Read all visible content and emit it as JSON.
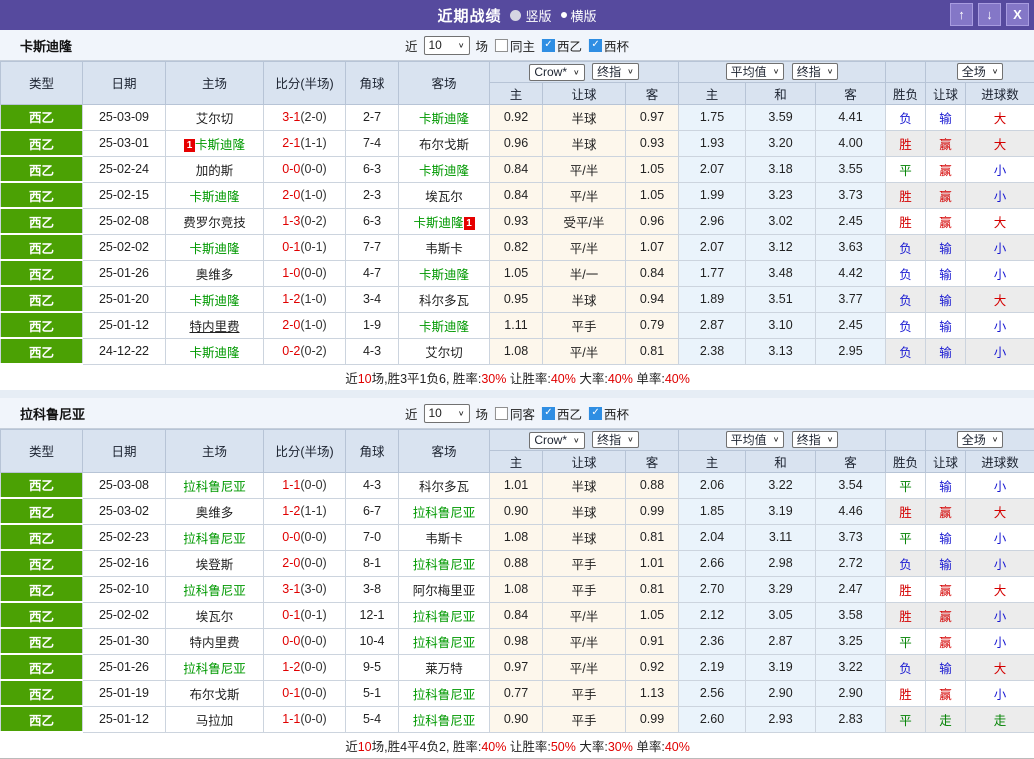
{
  "titlebar": {
    "title": "近期战绩",
    "vertical_label": "竖版",
    "horizontal_label": "横版"
  },
  "icons": {
    "chevron_down": "∨",
    "check": "✓",
    "up_arrow": "↑",
    "down_arrow": "↓",
    "close": "X"
  },
  "colors": {
    "accent": "#564a9e",
    "league_green": "#4ba104",
    "focus_green": "#009900",
    "score_red": "#e00000",
    "result_red": "#d40000",
    "result_blue": "#1a1ad2",
    "result_green": "#028202",
    "checkbox_blue": "#2f8ee3",
    "odds_cream_bg": "#fdf7ec",
    "avg_blue_bg": "#eaf3fb",
    "header_bg": "#d9e3f0"
  },
  "columns": {
    "main": [
      "类型",
      "日期",
      "主场",
      "比分(半场)",
      "角球",
      "客场"
    ],
    "sub": [
      "主",
      "让球",
      "客",
      "主",
      "和",
      "客",
      "胜负",
      "让球",
      "进球数"
    ]
  },
  "selects": {
    "crow": "Crow*",
    "final": "终指",
    "avg": "平均值",
    "full": "全场"
  },
  "tables": [
    {
      "team": "卡斯迪隆",
      "filter": {
        "near": "近",
        "count": "10",
        "games": "场",
        "same_label": "同主",
        "same_checked": false,
        "league_label": "西乙",
        "league_checked": true,
        "cup_label": "西杯",
        "cup_checked": true
      },
      "rows": [
        {
          "league": "西乙",
          "date": "25-03-09",
          "home": {
            "name": "艾尔切",
            "style": "normal"
          },
          "score": "3-1",
          "half": "(2-0)",
          "corner": "2-7",
          "away": {
            "name": "卡斯迪隆",
            "style": "focus"
          },
          "crow": [
            "0.92",
            "半球",
            "0.97"
          ],
          "avg": [
            "1.75",
            "3.59",
            "4.41"
          ],
          "result": [
            {
              "t": "负",
              "c": "blue"
            },
            {
              "t": "输",
              "c": "blue"
            },
            {
              "t": "大",
              "c": "red"
            }
          ]
        },
        {
          "league": "西乙",
          "date": "25-03-01",
          "home": {
            "name": "卡斯迪隆",
            "style": "focus",
            "badge": "1",
            "badge_pos": "before"
          },
          "score": "2-1",
          "half": "(1-1)",
          "corner": "7-4",
          "away": {
            "name": "布尔戈斯",
            "style": "normal"
          },
          "crow": [
            "0.96",
            "半球",
            "0.93"
          ],
          "avg": [
            "1.93",
            "3.20",
            "4.00"
          ],
          "result": [
            {
              "t": "胜",
              "c": "red"
            },
            {
              "t": "赢",
              "c": "red"
            },
            {
              "t": "大",
              "c": "red"
            }
          ]
        },
        {
          "league": "西乙",
          "date": "25-02-24",
          "home": {
            "name": "加的斯",
            "style": "normal"
          },
          "score": "0-0",
          "half": "(0-0)",
          "corner": "6-3",
          "away": {
            "name": "卡斯迪隆",
            "style": "focus"
          },
          "crow": [
            "0.84",
            "平/半",
            "1.05"
          ],
          "avg": [
            "2.07",
            "3.18",
            "3.55"
          ],
          "result": [
            {
              "t": "平",
              "c": "green"
            },
            {
              "t": "赢",
              "c": "red"
            },
            {
              "t": "小",
              "c": "blue"
            }
          ]
        },
        {
          "league": "西乙",
          "date": "25-02-15",
          "home": {
            "name": "卡斯迪隆",
            "style": "focus"
          },
          "score": "2-0",
          "half": "(1-0)",
          "corner": "2-3",
          "away": {
            "name": "埃瓦尔",
            "style": "normal"
          },
          "crow": [
            "0.84",
            "平/半",
            "1.05"
          ],
          "avg": [
            "1.99",
            "3.23",
            "3.73"
          ],
          "result": [
            {
              "t": "胜",
              "c": "red"
            },
            {
              "t": "赢",
              "c": "red"
            },
            {
              "t": "小",
              "c": "blue"
            }
          ]
        },
        {
          "league": "西乙",
          "date": "25-02-08",
          "home": {
            "name": "费罗尔竞技",
            "style": "normal"
          },
          "score": "1-3",
          "half": "(0-2)",
          "corner": "6-3",
          "away": {
            "name": "卡斯迪隆",
            "style": "focus",
            "badge": "1",
            "badge_pos": "after"
          },
          "crow": [
            "0.93",
            "受平/半",
            "0.96"
          ],
          "avg": [
            "2.96",
            "3.02",
            "2.45"
          ],
          "result": [
            {
              "t": "胜",
              "c": "red"
            },
            {
              "t": "赢",
              "c": "red"
            },
            {
              "t": "大",
              "c": "red"
            }
          ]
        },
        {
          "league": "西乙",
          "date": "25-02-02",
          "home": {
            "name": "卡斯迪隆",
            "style": "focus"
          },
          "score": "0-1",
          "half": "(0-1)",
          "corner": "7-7",
          "away": {
            "name": "韦斯卡",
            "style": "normal"
          },
          "crow": [
            "0.82",
            "平/半",
            "1.07"
          ],
          "avg": [
            "2.07",
            "3.12",
            "3.63"
          ],
          "result": [
            {
              "t": "负",
              "c": "blue"
            },
            {
              "t": "输",
              "c": "blue"
            },
            {
              "t": "小",
              "c": "blue"
            }
          ]
        },
        {
          "league": "西乙",
          "date": "25-01-26",
          "home": {
            "name": "奥维多",
            "style": "normal"
          },
          "score": "1-0",
          "half": "(0-0)",
          "corner": "4-7",
          "away": {
            "name": "卡斯迪隆",
            "style": "focus"
          },
          "crow": [
            "1.05",
            "半/一",
            "0.84"
          ],
          "avg": [
            "1.77",
            "3.48",
            "4.42"
          ],
          "result": [
            {
              "t": "负",
              "c": "blue"
            },
            {
              "t": "输",
              "c": "blue"
            },
            {
              "t": "小",
              "c": "blue"
            }
          ]
        },
        {
          "league": "西乙",
          "date": "25-01-20",
          "home": {
            "name": "卡斯迪隆",
            "style": "focus"
          },
          "score": "1-2",
          "half": "(1-0)",
          "corner": "3-4",
          "away": {
            "name": "科尔多瓦",
            "style": "normal"
          },
          "crow": [
            "0.95",
            "半球",
            "0.94"
          ],
          "avg": [
            "1.89",
            "3.51",
            "3.77"
          ],
          "result": [
            {
              "t": "负",
              "c": "blue"
            },
            {
              "t": "输",
              "c": "blue"
            },
            {
              "t": "大",
              "c": "red"
            }
          ]
        },
        {
          "league": "西乙",
          "date": "25-01-12",
          "home": {
            "name": "特内里费",
            "style": "underline"
          },
          "score": "2-0",
          "half": "(1-0)",
          "corner": "1-9",
          "away": {
            "name": "卡斯迪隆",
            "style": "focus"
          },
          "crow": [
            "1.11",
            "平手",
            "0.79"
          ],
          "avg": [
            "2.87",
            "3.10",
            "2.45"
          ],
          "result": [
            {
              "t": "负",
              "c": "blue"
            },
            {
              "t": "输",
              "c": "blue"
            },
            {
              "t": "小",
              "c": "blue"
            }
          ]
        },
        {
          "league": "西乙",
          "date": "24-12-22",
          "home": {
            "name": "卡斯迪隆",
            "style": "focus"
          },
          "score": "0-2",
          "half": "(0-2)",
          "corner": "4-3",
          "away": {
            "name": "艾尔切",
            "style": "normal"
          },
          "crow": [
            "1.08",
            "平/半",
            "0.81"
          ],
          "avg": [
            "2.38",
            "3.13",
            "2.95"
          ],
          "result": [
            {
              "t": "负",
              "c": "blue"
            },
            {
              "t": "输",
              "c": "blue"
            },
            {
              "t": "小",
              "c": "blue"
            }
          ]
        }
      ],
      "footer": [
        {
          "t": "近",
          "red": false
        },
        {
          "t": "10",
          "red": true
        },
        {
          "t": "场,胜3平1负6, 胜率:",
          "red": false
        },
        {
          "t": "30%",
          "red": true
        },
        {
          "t": " 让胜率:",
          "red": false
        },
        {
          "t": "40%",
          "red": true
        },
        {
          "t": " 大率:",
          "red": false
        },
        {
          "t": "40%",
          "red": true
        },
        {
          "t": " 单率:",
          "red": false
        },
        {
          "t": "40%",
          "red": true
        }
      ]
    },
    {
      "team": "拉科鲁尼亚",
      "filter": {
        "near": "近",
        "count": "10",
        "games": "场",
        "same_label": "同客",
        "same_checked": false,
        "league_label": "西乙",
        "league_checked": true,
        "cup_label": "西杯",
        "cup_checked": true
      },
      "rows": [
        {
          "league": "西乙",
          "date": "25-03-08",
          "home": {
            "name": "拉科鲁尼亚",
            "style": "focus"
          },
          "score": "1-1",
          "half": "(0-0)",
          "corner": "4-3",
          "away": {
            "name": "科尔多瓦",
            "style": "normal"
          },
          "crow": [
            "1.01",
            "半球",
            "0.88"
          ],
          "avg": [
            "2.06",
            "3.22",
            "3.54"
          ],
          "result": [
            {
              "t": "平",
              "c": "green"
            },
            {
              "t": "输",
              "c": "blue"
            },
            {
              "t": "小",
              "c": "blue"
            }
          ]
        },
        {
          "league": "西乙",
          "date": "25-03-02",
          "home": {
            "name": "奥维多",
            "style": "normal"
          },
          "score": "1-2",
          "half": "(1-1)",
          "corner": "6-7",
          "away": {
            "name": "拉科鲁尼亚",
            "style": "focus"
          },
          "crow": [
            "0.90",
            "半球",
            "0.99"
          ],
          "avg": [
            "1.85",
            "3.19",
            "4.46"
          ],
          "result": [
            {
              "t": "胜",
              "c": "red"
            },
            {
              "t": "赢",
              "c": "red"
            },
            {
              "t": "大",
              "c": "red"
            }
          ]
        },
        {
          "league": "西乙",
          "date": "25-02-23",
          "home": {
            "name": "拉科鲁尼亚",
            "style": "focus"
          },
          "score": "0-0",
          "half": "(0-0)",
          "corner": "7-0",
          "away": {
            "name": "韦斯卡",
            "style": "normal"
          },
          "crow": [
            "1.08",
            "半球",
            "0.81"
          ],
          "avg": [
            "2.04",
            "3.11",
            "3.73"
          ],
          "result": [
            {
              "t": "平",
              "c": "green"
            },
            {
              "t": "输",
              "c": "blue"
            },
            {
              "t": "小",
              "c": "blue"
            }
          ]
        },
        {
          "league": "西乙",
          "date": "25-02-16",
          "home": {
            "name": "埃登斯",
            "style": "normal"
          },
          "score": "2-0",
          "half": "(0-0)",
          "corner": "8-1",
          "away": {
            "name": "拉科鲁尼亚",
            "style": "focus"
          },
          "crow": [
            "0.88",
            "平手",
            "1.01"
          ],
          "avg": [
            "2.66",
            "2.98",
            "2.72"
          ],
          "result": [
            {
              "t": "负",
              "c": "blue"
            },
            {
              "t": "输",
              "c": "blue"
            },
            {
              "t": "小",
              "c": "blue"
            }
          ]
        },
        {
          "league": "西乙",
          "date": "25-02-10",
          "home": {
            "name": "拉科鲁尼亚",
            "style": "focus"
          },
          "score": "3-1",
          "half": "(3-0)",
          "corner": "3-8",
          "away": {
            "name": "阿尔梅里亚",
            "style": "normal"
          },
          "crow": [
            "1.08",
            "平手",
            "0.81"
          ],
          "avg": [
            "2.70",
            "3.29",
            "2.47"
          ],
          "result": [
            {
              "t": "胜",
              "c": "red"
            },
            {
              "t": "赢",
              "c": "red"
            },
            {
              "t": "大",
              "c": "red"
            }
          ]
        },
        {
          "league": "西乙",
          "date": "25-02-02",
          "home": {
            "name": "埃瓦尔",
            "style": "normal"
          },
          "score": "0-1",
          "half": "(0-1)",
          "corner": "12-1",
          "away": {
            "name": "拉科鲁尼亚",
            "style": "focus"
          },
          "crow": [
            "0.84",
            "平/半",
            "1.05"
          ],
          "avg": [
            "2.12",
            "3.05",
            "3.58"
          ],
          "result": [
            {
              "t": "胜",
              "c": "red"
            },
            {
              "t": "赢",
              "c": "red"
            },
            {
              "t": "小",
              "c": "blue"
            }
          ]
        },
        {
          "league": "西乙",
          "date": "25-01-30",
          "home": {
            "name": "特内里费",
            "style": "normal"
          },
          "score": "0-0",
          "half": "(0-0)",
          "corner": "10-4",
          "away": {
            "name": "拉科鲁尼亚",
            "style": "focus"
          },
          "crow": [
            "0.98",
            "平/半",
            "0.91"
          ],
          "avg": [
            "2.36",
            "2.87",
            "3.25"
          ],
          "result": [
            {
              "t": "平",
              "c": "green"
            },
            {
              "t": "赢",
              "c": "red"
            },
            {
              "t": "小",
              "c": "blue"
            }
          ]
        },
        {
          "league": "西乙",
          "date": "25-01-26",
          "home": {
            "name": "拉科鲁尼亚",
            "style": "focus"
          },
          "score": "1-2",
          "half": "(0-0)",
          "corner": "9-5",
          "away": {
            "name": "莱万特",
            "style": "normal"
          },
          "crow": [
            "0.97",
            "平/半",
            "0.92"
          ],
          "avg": [
            "2.19",
            "3.19",
            "3.22"
          ],
          "result": [
            {
              "t": "负",
              "c": "blue"
            },
            {
              "t": "输",
              "c": "blue"
            },
            {
              "t": "大",
              "c": "red"
            }
          ]
        },
        {
          "league": "西乙",
          "date": "25-01-19",
          "home": {
            "name": "布尔戈斯",
            "style": "normal"
          },
          "score": "0-1",
          "half": "(0-0)",
          "corner": "5-1",
          "away": {
            "name": "拉科鲁尼亚",
            "style": "focus"
          },
          "crow": [
            "0.77",
            "平手",
            "1.13"
          ],
          "avg": [
            "2.56",
            "2.90",
            "2.90"
          ],
          "result": [
            {
              "t": "胜",
              "c": "red"
            },
            {
              "t": "赢",
              "c": "red"
            },
            {
              "t": "小",
              "c": "blue"
            }
          ]
        },
        {
          "league": "西乙",
          "date": "25-01-12",
          "home": {
            "name": "马拉加",
            "style": "normal"
          },
          "score": "1-1",
          "half": "(0-0)",
          "corner": "5-4",
          "away": {
            "name": "拉科鲁尼亚",
            "style": "focus"
          },
          "crow": [
            "0.90",
            "平手",
            "0.99"
          ],
          "avg": [
            "2.60",
            "2.93",
            "2.83"
          ],
          "result": [
            {
              "t": "平",
              "c": "green"
            },
            {
              "t": "走",
              "c": "green"
            },
            {
              "t": "走",
              "c": "green"
            }
          ]
        }
      ],
      "footer": [
        {
          "t": "近",
          "red": false
        },
        {
          "t": "10",
          "red": true
        },
        {
          "t": "场,胜4平4负2, 胜率:",
          "red": false
        },
        {
          "t": "40%",
          "red": true
        },
        {
          "t": " 让胜率:",
          "red": false
        },
        {
          "t": "50%",
          "red": true
        },
        {
          "t": " 大率:",
          "red": false
        },
        {
          "t": "30%",
          "red": true
        },
        {
          "t": " 单率:",
          "red": false
        },
        {
          "t": "40%",
          "red": true
        }
      ]
    }
  ]
}
